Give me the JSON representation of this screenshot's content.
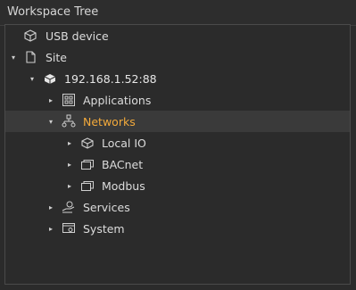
{
  "panel": {
    "title": "Workspace Tree"
  },
  "tree": {
    "items": [
      {
        "label": "USB device"
      },
      {
        "label": "Site"
      },
      {
        "label": "192.168.1.52:88"
      },
      {
        "label": "Applications"
      },
      {
        "label": "Networks"
      },
      {
        "label": "Local IO"
      },
      {
        "label": "BACnet"
      },
      {
        "label": "Modbus"
      },
      {
        "label": "Services"
      },
      {
        "label": "System"
      }
    ]
  },
  "colors": {
    "selected_text": "#f2a93b",
    "background": "#2b2b2b",
    "selected_row": "#3a3a3a"
  }
}
